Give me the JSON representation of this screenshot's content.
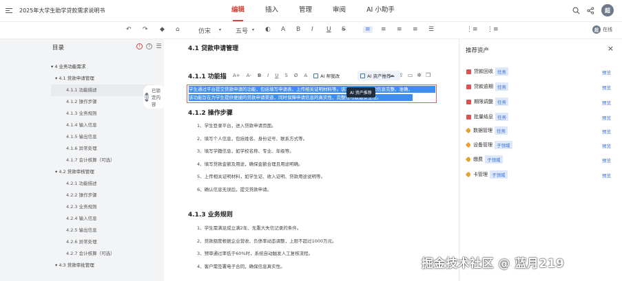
{
  "header": {
    "doc_title": "2025年大学生助学贷款需求说明书",
    "tabs": [
      {
        "label": "编辑",
        "active": true
      },
      {
        "label": "插入",
        "active": false
      },
      {
        "label": "管理",
        "active": false
      },
      {
        "label": "审阅",
        "active": false
      },
      {
        "label": "AI 小助手",
        "active": false
      }
    ],
    "user_avatar": "超"
  },
  "toolbar": {
    "undo_icon": "undo-icon",
    "redo_icon": "redo-icon",
    "font_family": "仿宋",
    "font_size": "五号",
    "bold": "B",
    "italic": "I",
    "underline": "U",
    "strike": "S",
    "online_label": "在线"
  },
  "toc": {
    "title": "目录",
    "items": [
      {
        "label": "▾ 4 业务功能需求",
        "level": 1
      },
      {
        "label": "▾ 4.1 贷款申请管理",
        "level": 2
      },
      {
        "label": "4.1.1 功能描述",
        "level": 3,
        "active": true
      },
      {
        "label": "4.1.2 操作步骤",
        "level": 3
      },
      {
        "label": "4.1.3 业务规则",
        "level": 3
      },
      {
        "label": "4.1.4 输入信息",
        "level": 3
      },
      {
        "label": "4.1.5 输出信息",
        "level": 3
      },
      {
        "label": "4.1.6 异常处理",
        "level": 3
      },
      {
        "label": "4.1.7 会计核算（可选）",
        "level": 3
      },
      {
        "label": "▾ 4.2 贷款审核管理",
        "level": 2
      },
      {
        "label": "4.2.1 功能描述",
        "level": 3
      },
      {
        "label": "4.2.2 操作步骤",
        "level": 3
      },
      {
        "label": "4.2.3 业务规则",
        "level": 3
      },
      {
        "label": "4.2.4 输入信息",
        "level": 3
      },
      {
        "label": "4.2.5 输出信息",
        "level": 3
      },
      {
        "label": "4.2.6 异常处理",
        "level": 3
      },
      {
        "label": "4.2.7 会计核算（可选）",
        "level": 3
      },
      {
        "label": "▾ 4.3 贷款审批管理",
        "level": 2
      }
    ],
    "assistant_tag": "已锁定内容",
    "assistant_avatar": "超"
  },
  "document": {
    "section_title": "4.1 贷款申请管理",
    "sub1_title": "4.1.1 功能描",
    "inline_toolbar": {
      "items": [
        "A+",
        "A-",
        "B",
        "I",
        "U",
        "S",
        "Ø",
        "A"
      ],
      "ai_rewrite": "AI 帮我改",
      "ai_asset": "AI 资产推荐"
    },
    "tooltip": "AI 资产推荐",
    "selected_lines": [
      "学生通过平台提交贷款申请的功能，包括填写申请表、上传相关证明材料等。该功能需确保申请信息完整、准确，",
      "该功能旨在为学生提供便捷的贷款申请渠道，同时保障申请信息的真实性、完整性与数据安全性。"
    ],
    "sub2_title": "4.1.2 操作步骤",
    "steps": [
      "1、学生登录平台，进入贷款申请页面。",
      "2、填写个人信息，包括姓名、身份证号、联系方式等。",
      "3、填写学籍信息，如学校名称、专业、年级等。",
      "4、填写贷款金额及用途，确保金额合理且用途明确。",
      "5、上传相关证明材料，如学生证、收入证明、贷款用途说明等。",
      "6、确认信息无误后，提交贷款申请。"
    ],
    "sub3_title": "4.1.3 业务规则",
    "rules": [
      "1、学生需满足成立满2年、无重大失信记录的条件。",
      "2、贷款额度根据企业营收、负债率动态调整，上限不超过1000万元。",
      "3、预审通过率低于60%时，系统自动触发人工复核流程。",
      "4、客户需签署电子合同，确保信息真实性。"
    ]
  },
  "assets": {
    "title": "推荐资产",
    "preview_label": "预览",
    "items": [
      {
        "name": "贷款回收",
        "badge": "任务",
        "icon": "document-icon"
      },
      {
        "name": "贷款逾期",
        "badge": "任务",
        "icon": "document-icon"
      },
      {
        "name": "期限调整",
        "badge": "任务",
        "icon": "document-icon"
      },
      {
        "name": "批量结息",
        "badge": "任务",
        "icon": "document-icon"
      },
      {
        "name": "数据管理",
        "badge": "任务",
        "icon": "tag-icon"
      },
      {
        "name": "设备管理",
        "badge": "子领域",
        "icon": "tag-icon"
      },
      {
        "name": "缴费",
        "badge": "子领域",
        "icon": "tag-icon"
      },
      {
        "name": "卡管理",
        "badge": "子领域",
        "icon": "tag-icon"
      }
    ]
  },
  "watermark": "掘金技术社区 @ 蓝月219"
}
